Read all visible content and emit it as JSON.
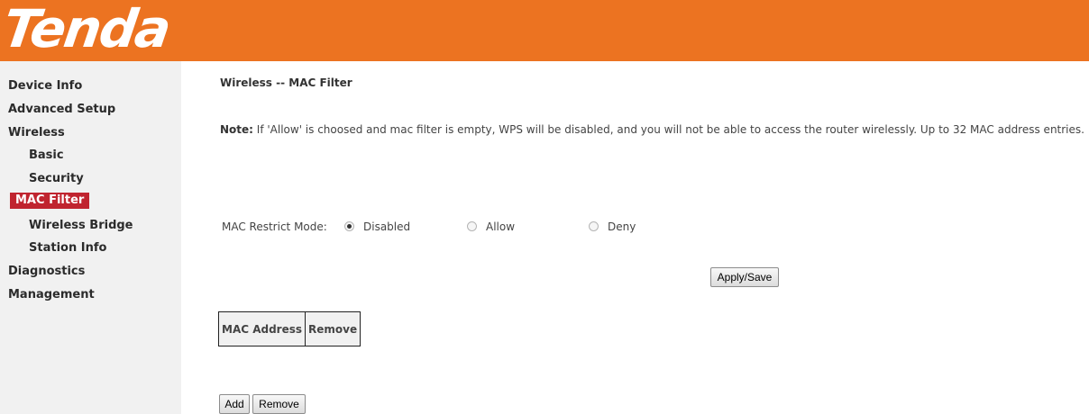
{
  "brand": {
    "logo_text": "Tenda",
    "header_color": "#ec7321"
  },
  "sidebar": {
    "items": [
      {
        "label": "Device Info"
      },
      {
        "label": "Advanced Setup"
      },
      {
        "label": "Wireless"
      },
      {
        "label": "Basic"
      },
      {
        "label": "Security"
      },
      {
        "label": "MAC Filter",
        "active": true
      },
      {
        "label": "Wireless Bridge"
      },
      {
        "label": "Station Info"
      },
      {
        "label": "Diagnostics"
      },
      {
        "label": "Management"
      }
    ],
    "active_color": "#c0242f"
  },
  "main": {
    "title": "Wireless -- MAC Filter",
    "note_label": "Note:",
    "note_text": " If 'Allow' is choosed and mac filter is empty, WPS will be disabled, and you will not be able to access the router wirelessly. Up to 32 MAC address entries.",
    "mode": {
      "label": "MAC Restrict Mode:",
      "options": [
        "Disabled",
        "Allow",
        "Deny"
      ],
      "selected": "Disabled"
    },
    "apply_label": "Apply/Save",
    "table": {
      "headers": [
        "MAC Address",
        "Remove"
      ]
    },
    "add_label": "Add",
    "remove_label": "Remove"
  }
}
